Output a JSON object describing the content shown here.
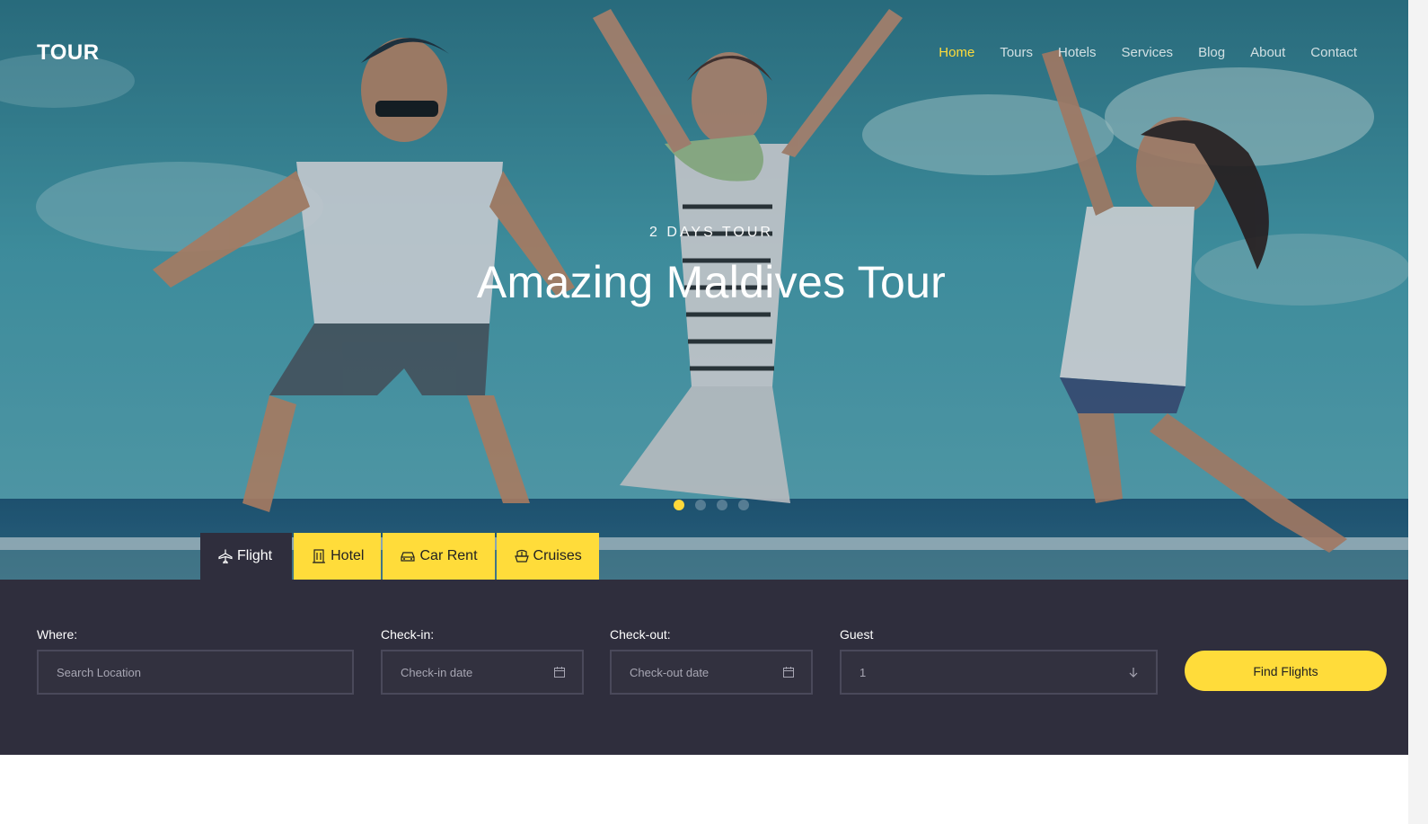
{
  "brand": {
    "logo": "TOUR"
  },
  "nav": {
    "items": [
      {
        "label": "Home",
        "active": true
      },
      {
        "label": "Tours",
        "active": false
      },
      {
        "label": "Hotels",
        "active": false
      },
      {
        "label": "Services",
        "active": false
      },
      {
        "label": "Blog",
        "active": false
      },
      {
        "label": "About",
        "active": false
      },
      {
        "label": "Contact",
        "active": false
      }
    ]
  },
  "hero": {
    "subtitle": "2 DAYS TOUR",
    "title": "Amazing Maldives Tour",
    "slides": 4,
    "active_slide": 1
  },
  "tabs": [
    {
      "label": "Flight",
      "icon": "plane-icon",
      "active": true
    },
    {
      "label": "Hotel",
      "icon": "building-icon",
      "active": false
    },
    {
      "label": "Car Rent",
      "icon": "car-icon",
      "active": false
    },
    {
      "label": "Cruises",
      "icon": "ship-icon",
      "active": false
    }
  ],
  "search": {
    "where_label": "Where:",
    "where_placeholder": "Search Location",
    "checkin_label": "Check-in:",
    "checkin_placeholder": "Check-in date",
    "checkout_label": "Check-out:",
    "checkout_placeholder": "Check-out date",
    "guest_label": "Guest",
    "guest_value": "1",
    "submit_label": "Find Flights"
  },
  "colors": {
    "accent": "#ffdc3a",
    "panel": "#2f2e3d",
    "nav_active": "#ffdc3a"
  }
}
